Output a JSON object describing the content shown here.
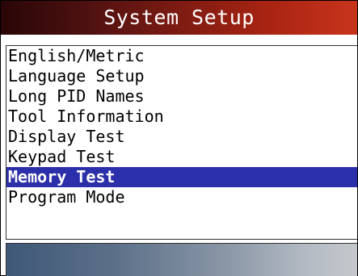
{
  "header": {
    "title": "System Setup"
  },
  "menu": {
    "items": [
      {
        "label": "English/Metric",
        "selected": false
      },
      {
        "label": "Language Setup",
        "selected": false
      },
      {
        "label": "Long PID Names",
        "selected": false
      },
      {
        "label": "Tool Information",
        "selected": false
      },
      {
        "label": "Display Test",
        "selected": false
      },
      {
        "label": "Keypad Test",
        "selected": false
      },
      {
        "label": "Memory Test",
        "selected": true
      },
      {
        "label": "Program Mode",
        "selected": false
      }
    ]
  },
  "colors": {
    "highlight": "#2b2fa9",
    "title_gradient_start": "#2a0606",
    "title_gradient_end": "#c8341c",
    "status_gradient_start": "#3f5878",
    "status_gradient_end": "#c4c8cc"
  }
}
